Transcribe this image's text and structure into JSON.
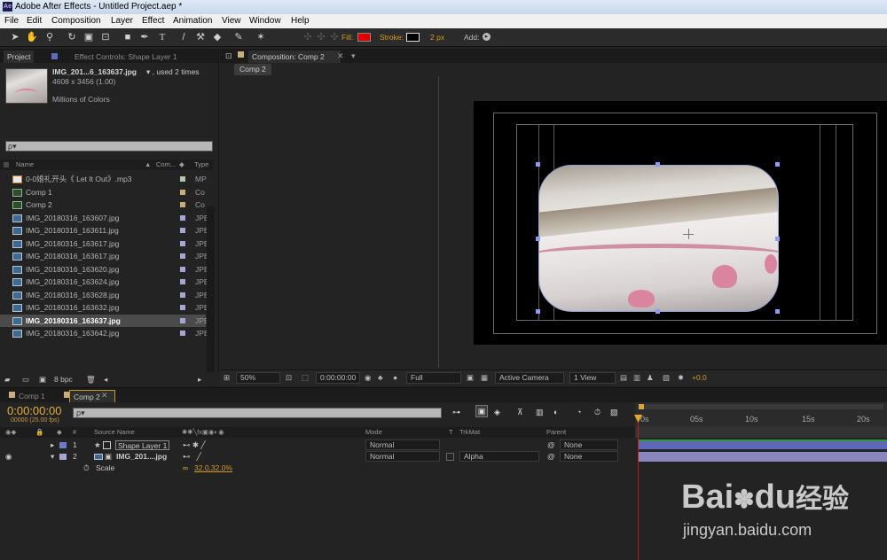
{
  "window": {
    "app_icon": "Ae",
    "title": "Adobe After Effects - Untitled Project.aep *"
  },
  "menu": [
    "File",
    "Edit",
    "Composition",
    "Layer",
    "Effect",
    "Animation",
    "View",
    "Window",
    "Help"
  ],
  "toolbar": {
    "fill_label": "Fill:",
    "fill_color": "#e00000",
    "stroke_label": "Stroke:",
    "stroke_width": "2 px",
    "add_label": "Add:"
  },
  "project": {
    "tab_project": "Project",
    "tab_effects": "Effect Controls: Shape Layer 1",
    "file_name": "IMG_201...6_163637.jpg",
    "used": "▾ , used 2 times",
    "dims": "4608 x 3456 (1.00)",
    "colors": "Millions of Colors",
    "search_placeholder": "ρ▾",
    "col_name": "Name",
    "col_comment": "Com...",
    "col_type": "Type",
    "bpc": "8 bpc",
    "items": [
      {
        "name": "0-0婚礼开头《 Let It Out》.mp3",
        "type": "MP",
        "icon": "audio",
        "swatch": "#b3c8a8"
      },
      {
        "name": "Comp 1",
        "type": "Co",
        "icon": "comp",
        "swatch": "#c8ad7d"
      },
      {
        "name": "Comp 2",
        "type": "Co",
        "icon": "comp",
        "swatch": "#c8ad7d"
      },
      {
        "name": "IMG_20180316_163607.jpg",
        "type": "JPE",
        "icon": "img",
        "swatch": "#a7a6d3"
      },
      {
        "name": "IMG_20180316_163611.jpg",
        "type": "JPE",
        "icon": "img",
        "swatch": "#a7a6d3"
      },
      {
        "name": "IMG_20180316_163617.jpg",
        "type": "JPE",
        "icon": "img",
        "swatch": "#a7a6d3"
      },
      {
        "name": "IMG_20180316_163617.jpg",
        "type": "JPE",
        "icon": "img",
        "swatch": "#a7a6d3"
      },
      {
        "name": "IMG_20180316_163620.jpg",
        "type": "JPE",
        "icon": "img",
        "swatch": "#a7a6d3"
      },
      {
        "name": "IMG_20180316_163624.jpg",
        "type": "JPE",
        "icon": "img",
        "swatch": "#a7a6d3"
      },
      {
        "name": "IMG_20180316_163628.jpg",
        "type": "JPE",
        "icon": "img",
        "swatch": "#a7a6d3"
      },
      {
        "name": "IMG_20180316_163632.jpg",
        "type": "JPE",
        "icon": "img",
        "swatch": "#a7a6d3"
      },
      {
        "name": "IMG_20180316_163637.jpg",
        "type": "JPE",
        "icon": "img",
        "swatch": "#a7a6d3",
        "selected": true
      },
      {
        "name": "IMG_20180316_163642.jpg",
        "type": "JPE",
        "icon": "img",
        "swatch": "#a7a6d3"
      }
    ]
  },
  "composition": {
    "tab": "Composition: Comp 2",
    "breadcrumb": "Comp 2",
    "zoom": "50%",
    "timecode": "0:00:00:00",
    "resolution": "Full",
    "camera": "Active Camera",
    "views": "1 View",
    "exposure": "+0.0"
  },
  "timeline": {
    "tab1": "Comp 1",
    "tab2": "Comp 2",
    "timecode": "0:00:00:00",
    "fps": "00000 (25.00 fps)",
    "search_placeholder": "ρ▾",
    "cols": {
      "num": "#",
      "source": "Source Name",
      "mode": "Mode",
      "t": "T",
      "trkmat": "TrkMat",
      "parent": "Parent"
    },
    "layers": [
      {
        "num": "1",
        "name": "Shape Layer 1",
        "mode": "Normal",
        "trkmat": "",
        "parent": "None",
        "color": "#6e7cc8"
      },
      {
        "num": "2",
        "name": "IMG_201....jpg",
        "mode": "Normal",
        "trkmat": "Alpha",
        "parent": "None",
        "color": "#a7a6d3"
      }
    ],
    "property": {
      "name": "Scale",
      "value": "32.0,32.0%"
    },
    "ruler": [
      "0s",
      "05s",
      "10s",
      "15s",
      "20s"
    ]
  },
  "watermark": {
    "text1": "Bai",
    "text2": "du",
    "text3": "经验",
    "url": "jingyan.baidu.com"
  }
}
